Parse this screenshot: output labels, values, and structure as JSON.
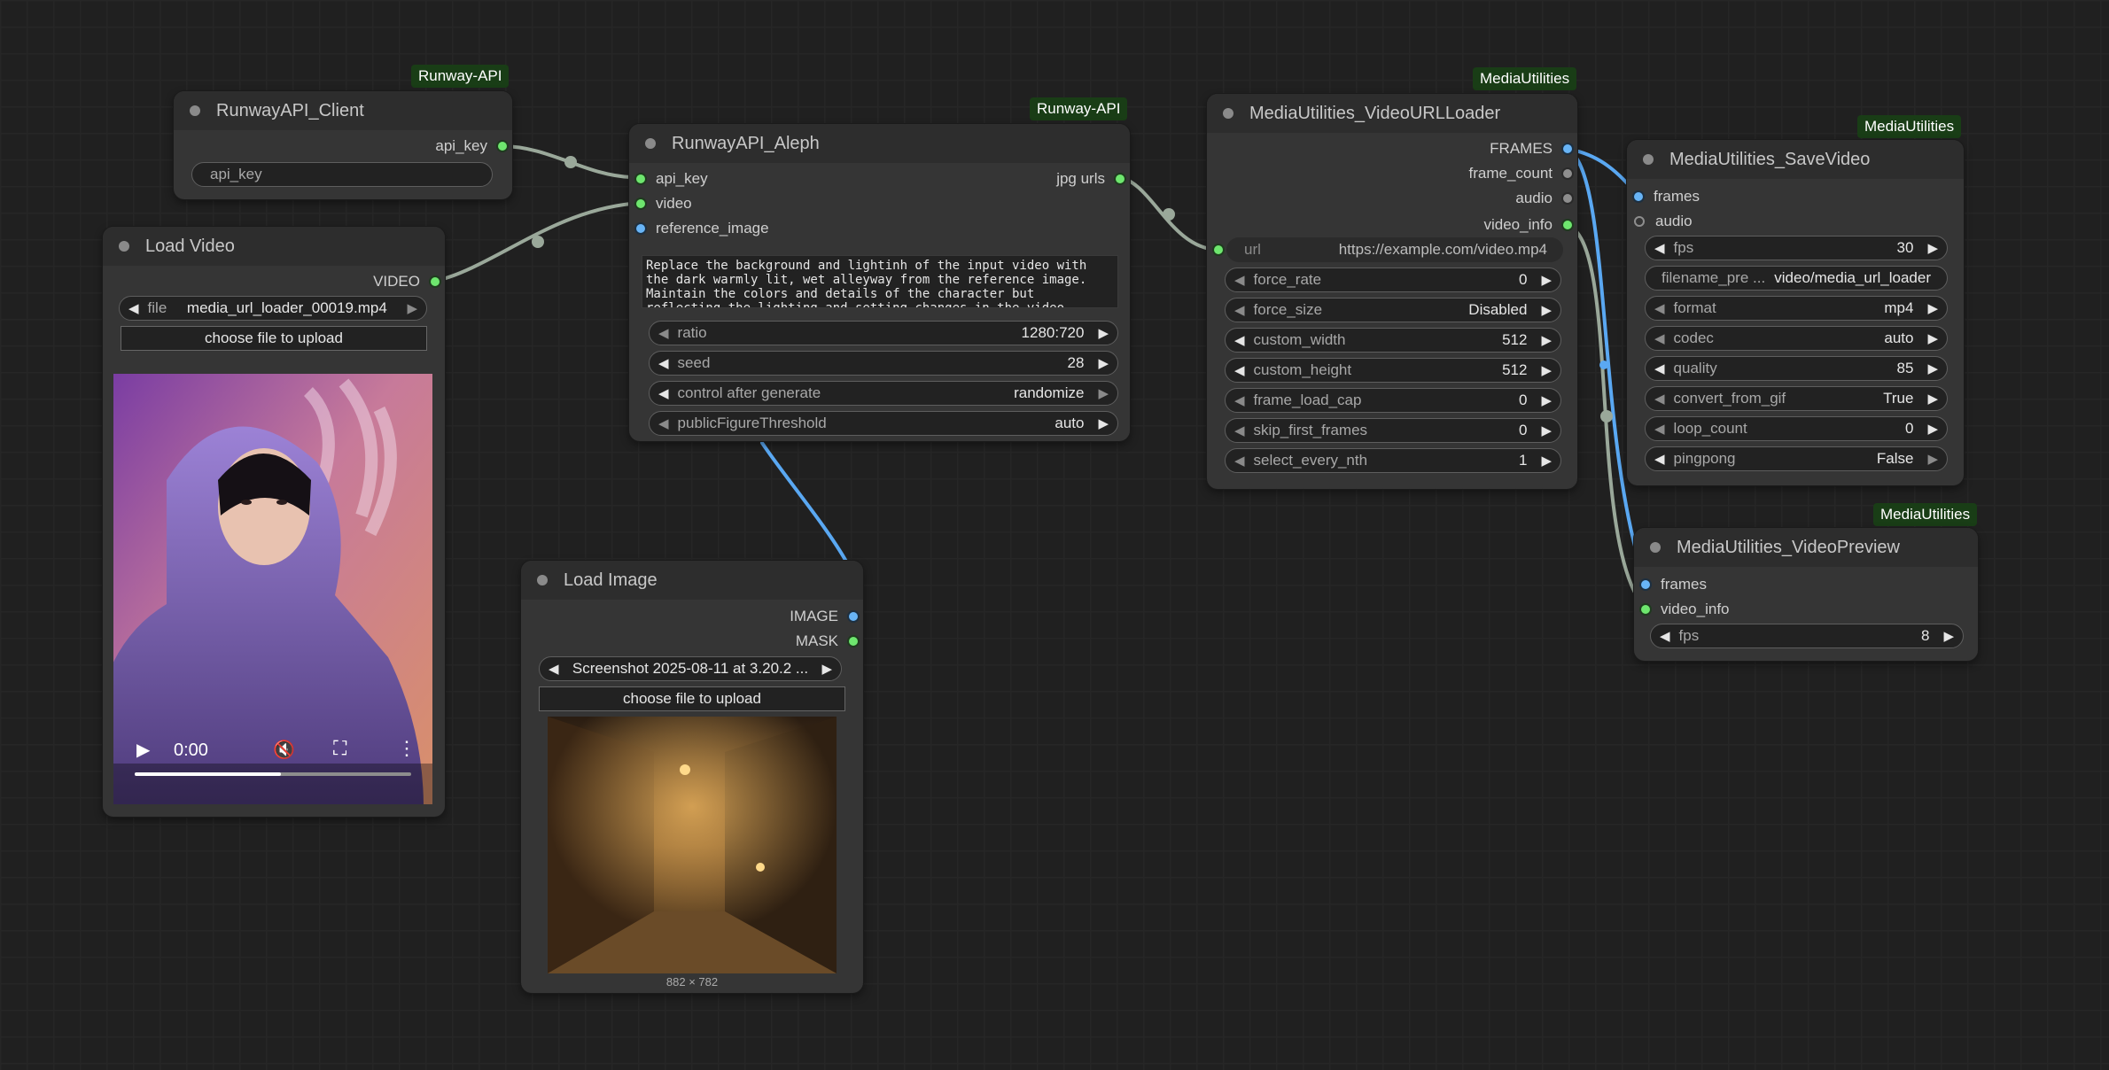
{
  "nodes": {
    "client": {
      "badge": "Runway-API",
      "title": "RunwayAPI_Client",
      "output": "api_key",
      "input_value": "api_key"
    },
    "load_video": {
      "title": "Load Video",
      "output": "VIDEO",
      "file_label": "file",
      "file_value": "media_url_loader_00019.mp4",
      "upload_label": "choose file to upload",
      "player": {
        "time": "0:00",
        "progress": 0.53
      }
    },
    "aleph": {
      "badge": "Runway-API",
      "title": "RunwayAPI_Aleph",
      "inputs": [
        "api_key",
        "video",
        "reference_image"
      ],
      "output": "jpg urls",
      "prompt": "Replace the background and lightinh of the input video with the dark warmly lit, wet alleyway from the reference image. Maintain the colors and details of the character but reflecting the lighting and setting changes in the video",
      "widgets": [
        {
          "label": "ratio",
          "value": "1280:720"
        },
        {
          "label": "seed",
          "value": "28"
        },
        {
          "label": "control after generate",
          "value": "randomize"
        },
        {
          "label": "publicFigureThreshold",
          "value": "auto"
        }
      ]
    },
    "load_image": {
      "title": "Load Image",
      "outputs": [
        "IMAGE",
        "MASK"
      ],
      "file_value": "Screenshot 2025-08-11 at 3.20.2 ...",
      "upload_label": "choose file to upload",
      "dimensions": "882 × 782"
    },
    "url_loader": {
      "badge": "MediaUtilities",
      "title": "MediaUtilities_VideoURLLoader",
      "outputs": [
        "FRAMES",
        "frame_count",
        "audio",
        "video_info"
      ],
      "url_label": "url",
      "url_value": "https://example.com/video.mp4",
      "widgets": [
        {
          "label": "force_rate",
          "value": "0"
        },
        {
          "label": "force_size",
          "value": "Disabled"
        },
        {
          "label": "custom_width",
          "value": "512"
        },
        {
          "label": "custom_height",
          "value": "512"
        },
        {
          "label": "frame_load_cap",
          "value": "0"
        },
        {
          "label": "skip_first_frames",
          "value": "0"
        },
        {
          "label": "select_every_nth",
          "value": "1"
        }
      ]
    },
    "save_video": {
      "badge": "MediaUtilities",
      "title": "MediaUtilities_SaveVideo",
      "inputs": [
        "frames",
        "audio"
      ],
      "widgets": [
        {
          "label": "fps",
          "value": "30"
        },
        {
          "label": "filename_pre ...",
          "value": "video/media_url_loader"
        },
        {
          "label": "format",
          "value": "mp4"
        },
        {
          "label": "codec",
          "value": "auto"
        },
        {
          "label": "quality",
          "value": "85"
        },
        {
          "label": "convert_from_gif",
          "value": "True"
        },
        {
          "label": "loop_count",
          "value": "0"
        },
        {
          "label": "pingpong",
          "value": "False"
        }
      ]
    },
    "preview": {
      "badge": "MediaUtilities",
      "title": "MediaUtilities_VideoPreview",
      "inputs": [
        "frames",
        "video_info"
      ],
      "widget": {
        "label": "fps",
        "value": "8"
      }
    }
  },
  "colors": {
    "canvas_bg": "#202020",
    "node_bg": "#353535",
    "node_title_bg": "#2d2d2d",
    "badge_bg": "#193d16",
    "slot_green": "#6ee66e",
    "slot_blue": "#68b4f6",
    "link_gray": "#9aa89a",
    "link_blue": "#5aa8f2"
  },
  "icons": [
    "play-icon",
    "volume-muted-icon",
    "fullscreen-icon",
    "more-vert-icon",
    "arrow-left-icon",
    "arrow-right-icon"
  ]
}
